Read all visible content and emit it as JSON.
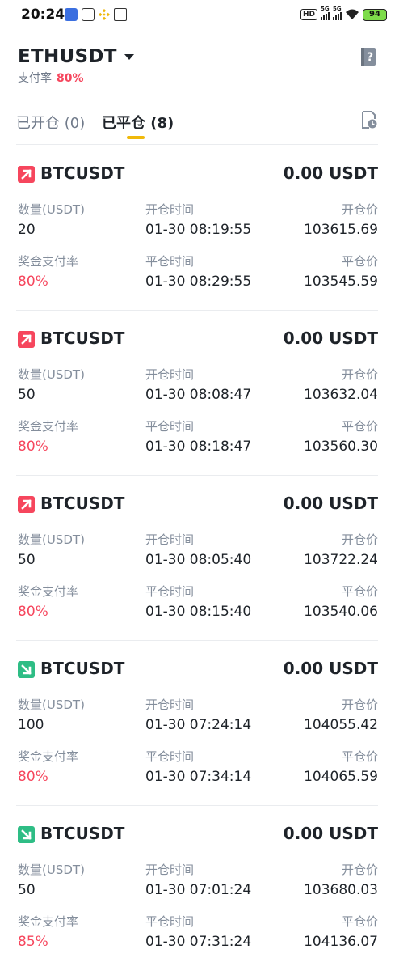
{
  "status_bar": {
    "time": "20:24",
    "network_label": "HD",
    "sim1_tag": "5G",
    "sim2_tag": "5G",
    "battery": "94"
  },
  "header": {
    "symbol": "ETHUSDT",
    "payout_label": "支付率",
    "payout_value": "80%"
  },
  "tabs": {
    "open_label": "已开仓 (0)",
    "closed_label": "已平仓 (8)"
  },
  "labels": {
    "quantity": "数量(USDT)",
    "open_time": "开仓时间",
    "open_price": "开仓价",
    "payout_rate": "奖金支付率",
    "close_time": "平仓时间",
    "close_price": "平仓价"
  },
  "colors": {
    "up": "#f6465d",
    "down": "#2ebd85",
    "accent": "#f0b90b"
  },
  "orders": [
    {
      "direction": "up",
      "icon": "arrow-up-right-icon",
      "symbol": "BTCUSDT",
      "pnl": "0.00 USDT",
      "quantity": "20",
      "open_time": "01-30 08:19:55",
      "open_price": "103615.69",
      "payout_rate": "80%",
      "close_time": "01-30 08:29:55",
      "close_price": "103545.59"
    },
    {
      "direction": "up",
      "icon": "arrow-up-right-icon",
      "symbol": "BTCUSDT",
      "pnl": "0.00 USDT",
      "quantity": "50",
      "open_time": "01-30 08:08:47",
      "open_price": "103632.04",
      "payout_rate": "80%",
      "close_time": "01-30 08:18:47",
      "close_price": "103560.30"
    },
    {
      "direction": "up",
      "icon": "arrow-up-right-icon",
      "symbol": "BTCUSDT",
      "pnl": "0.00 USDT",
      "quantity": "50",
      "open_time": "01-30 08:05:40",
      "open_price": "103722.24",
      "payout_rate": "80%",
      "close_time": "01-30 08:15:40",
      "close_price": "103540.06"
    },
    {
      "direction": "down",
      "icon": "arrow-down-right-icon",
      "symbol": "BTCUSDT",
      "pnl": "0.00 USDT",
      "quantity": "100",
      "open_time": "01-30 07:24:14",
      "open_price": "104055.42",
      "payout_rate": "80%",
      "close_time": "01-30 07:34:14",
      "close_price": "104065.59"
    },
    {
      "direction": "down",
      "icon": "arrow-down-right-icon",
      "symbol": "BTCUSDT",
      "pnl": "0.00 USDT",
      "quantity": "50",
      "open_time": "01-30 07:01:24",
      "open_price": "103680.03",
      "payout_rate": "85%",
      "close_time": "01-30 07:31:24",
      "close_price": "104136.07"
    }
  ]
}
